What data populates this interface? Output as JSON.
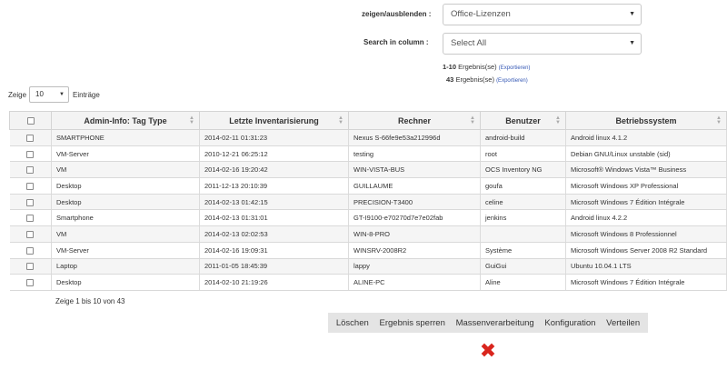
{
  "filters": {
    "show_hide_label": "zeigen/ausblenden :",
    "show_hide_value": "Office-Lizenzen",
    "search_col_label": "Search in column :",
    "search_col_value": "Select All"
  },
  "results": {
    "line1_count": "1-10",
    "line1_text": "Ergebnis(se)",
    "line1_export": "(Exportieren)",
    "line2_count": "43",
    "line2_text": "Ergebnis(se)",
    "line2_export": "(Exportieren)"
  },
  "length": {
    "prefix": "Zeige",
    "value": "10",
    "suffix": "Einträge"
  },
  "table": {
    "headers": [
      "Admin-Info: Tag Type",
      "Letzte Inventarisierung",
      "Rechner",
      "Benutzer",
      "Betriebssystem"
    ],
    "rows": [
      [
        "SMARTPHONE",
        "2014-02-11 01:31:23",
        "Nexus S-66fe9e53a212996d",
        "android-build",
        "Android linux 4.1.2"
      ],
      [
        "VM-Server",
        "2010-12-21 06:25:12",
        "testing",
        "root",
        "Debian GNU/Linux unstable (sid)"
      ],
      [
        "VM",
        "2014-02-16 19:20:42",
        "WIN-VISTA-BUS",
        "OCS Inventory NG",
        "Microsoft® Windows Vista™ Business"
      ],
      [
        "Desktop",
        "2011-12-13 20:10:39",
        "GUILLAUME",
        "goufa",
        "Microsoft Windows XP Professional"
      ],
      [
        "Desktop",
        "2014-02-13 01:42:15",
        "PRECISION-T3400",
        "celine",
        "Microsoft Windows 7 Édition Intégrale"
      ],
      [
        "Smartphone",
        "2014-02-13 01:31:01",
        "GT-I9100-e70270d7e7e02fab",
        "jenkins",
        "Android linux 4.2.2"
      ],
      [
        "VM",
        "2014-02-13 02:02:53",
        "WIN-8-PRO",
        "",
        "Microsoft Windows 8 Professionnel"
      ],
      [
        "VM-Server",
        "2014-02-16 19:09:31",
        "WINSRV-2008R2",
        "Système",
        "Microsoft Windows Server 2008 R2 Standard"
      ],
      [
        "Laptop",
        "2011-01-05 18:45:39",
        "lappy",
        "GuiGui",
        "Ubuntu 10.04.1 LTS"
      ],
      [
        "Desktop",
        "2014-02-10 21:19:26",
        "ALINE-PC",
        "Aline",
        "Microsoft Windows 7 Édition Intégrale"
      ]
    ]
  },
  "info": "Zeige 1 bis 10 von 43",
  "actions": {
    "delete": "Löschen",
    "lock": "Ergebnis sperren",
    "mass": "Massenverarbeitung",
    "config": "Konfiguration",
    "distribute": "Verteilen"
  },
  "icons": {
    "close": "close-icon",
    "caret": "chevron-down-icon",
    "sort": "sort-icon"
  },
  "colors": {
    "link": "#3558b5",
    "close_red": "#d9251d",
    "action_bar": "#e4e4e4"
  }
}
